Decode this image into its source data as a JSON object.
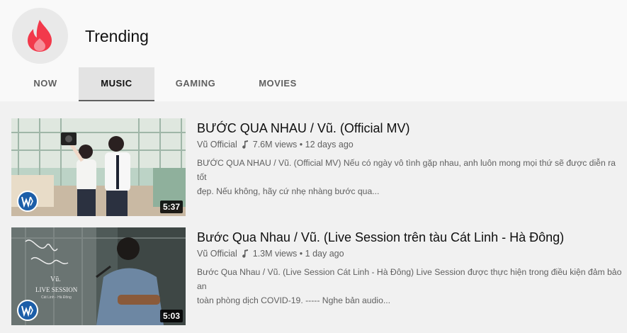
{
  "header": {
    "title": "Trending"
  },
  "tabs": [
    {
      "label": "NOW"
    },
    {
      "label": "MUSIC",
      "active": true
    },
    {
      "label": "GAMING"
    },
    {
      "label": "MOVIES"
    }
  ],
  "videos": [
    {
      "title": "BƯỚC QUA NHAU / Vũ. (Official MV)",
      "channel": "Vũ Official",
      "views": "7.6M views",
      "age": "12 days ago",
      "description_line1": "BƯỚC QUA NHAU / Vũ. (Official MV) Nếu có ngày vô tình gặp nhau, anh luôn mong mọi thứ sẽ được diễn ra tốt",
      "description_line2": "đẹp. Nếu không, hãy cứ nhẹ nhàng bước qua...",
      "duration": "5:37"
    },
    {
      "title": "Bước Qua Nhau / Vũ. (Live Session trên tàu Cát Linh - Hà Đông)",
      "channel": "Vũ Official",
      "views": "1.3M views",
      "age": "1 day ago",
      "description_line1": "Bước Qua Nhau / Vũ. (Live Session Cát Linh - Hà Đông) Live Session được thực hiện trong điều kiện đảm bảo an",
      "description_line2": "toàn phòng dịch COVID-19. ----- Nghe bản audio...",
      "duration": "5:03",
      "thumb_text": {
        "artist": "Vũ.",
        "session": "LIVE SESSION",
        "place": "Cát Linh - Hà Đông"
      }
    }
  ],
  "separator": "•",
  "icons": {
    "trending": "flame-icon",
    "note": "music-note-icon",
    "label_badge": "warner-logo-icon"
  },
  "colors": {
    "flame": "#f2394b",
    "active_tab_bg": "#e3e3e3",
    "badge": "#1c5ea8"
  }
}
